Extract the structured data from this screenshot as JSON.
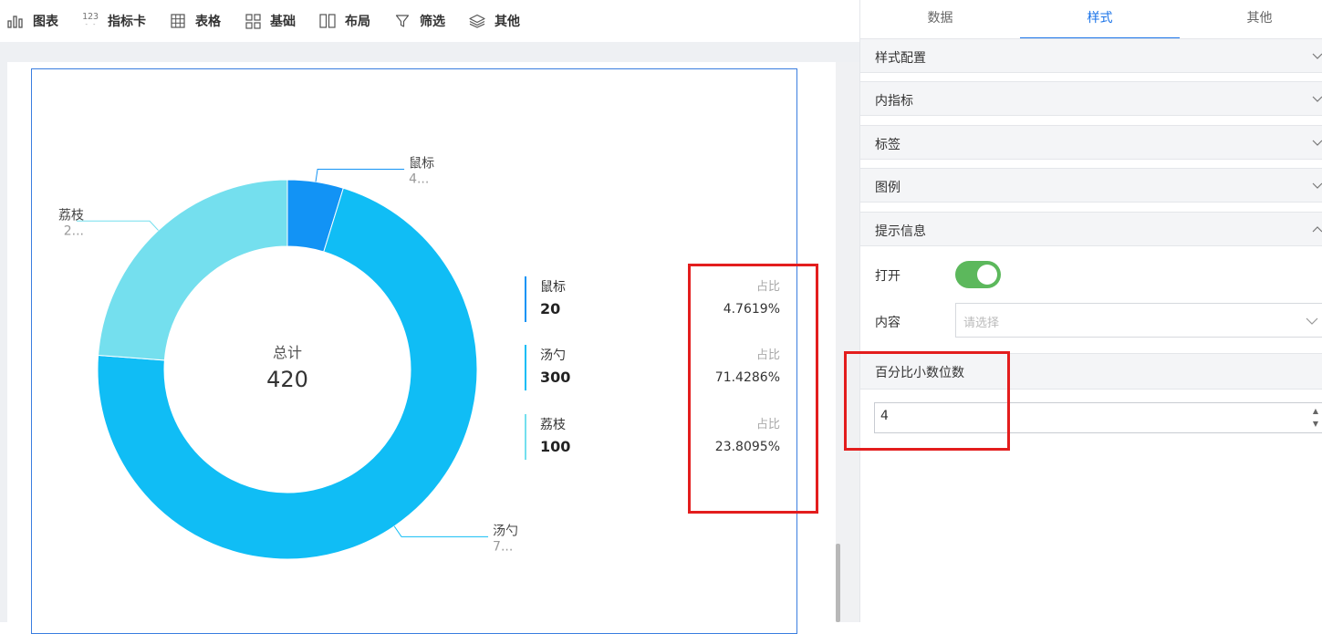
{
  "toolbar": {
    "items": [
      {
        "label": "图表",
        "icon": "bar-chart-icon"
      },
      {
        "label": "指标卡",
        "icon": "number-icon",
        "icon_text": "123"
      },
      {
        "label": "表格",
        "icon": "table-icon"
      },
      {
        "label": "基础",
        "icon": "grid-icon"
      },
      {
        "label": "布局",
        "icon": "layout-icon"
      },
      {
        "label": "筛选",
        "icon": "filter-icon"
      },
      {
        "label": "其他",
        "icon": "layers-icon"
      }
    ]
  },
  "chart_data": {
    "type": "pie",
    "variant": "donut",
    "center": {
      "label": "总计",
      "value": 420
    },
    "categories": [
      "鼠标",
      "汤勺",
      "荔枝"
    ],
    "values": [
      20,
      300,
      100
    ],
    "colors": [
      "#1293f5",
      "#10bdf5",
      "#74dfee"
    ],
    "outside_labels": [
      {
        "name": "鼠标",
        "value": "4..."
      },
      {
        "name": "汤勺",
        "value": "7..."
      },
      {
        "name": "荔枝",
        "value": "2..."
      }
    ],
    "legend": [
      {
        "name": "鼠标",
        "value": "20",
        "ratio_label": "占比",
        "ratio": "4.7619%"
      },
      {
        "name": "汤勺",
        "value": "300",
        "ratio_label": "占比",
        "ratio": "71.4286%"
      },
      {
        "name": "荔枝",
        "value": "100",
        "ratio_label": "占比",
        "ratio": "23.8095%"
      }
    ]
  },
  "panel": {
    "tabs": [
      {
        "label": "数据",
        "active": false
      },
      {
        "label": "样式",
        "active": true
      },
      {
        "label": "其他",
        "active": false
      }
    ],
    "sections": [
      {
        "title": "样式配置",
        "expanded": false
      },
      {
        "title": "内指标",
        "expanded": false
      },
      {
        "title": "标签",
        "expanded": false
      },
      {
        "title": "图例",
        "expanded": false
      },
      {
        "title": "提示信息",
        "expanded": true
      }
    ],
    "tooltip": {
      "open_label": "打开",
      "open_value": true,
      "content_label": "内容",
      "content_placeholder": "请选择"
    },
    "decimals": {
      "title": "百分比小数位数",
      "value": "4"
    }
  },
  "colors": {
    "accent": "#1a73e8",
    "toggle_on": "#5cb85c",
    "highlight": "#e31d1d",
    "selection": "#3a7ee0"
  }
}
